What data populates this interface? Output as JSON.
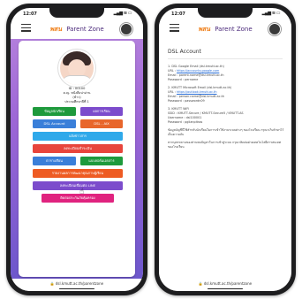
{
  "status_time": "12:07",
  "brand": {
    "logo": "พสน",
    "title": "Parent Zone"
  },
  "left": {
    "student": {
      "id": "ID : 00100",
      "name": "ด.ญ. หนังสือน่าอ่าน",
      "nick": "(ข้าว)",
      "class": "ประถมศึกษาปีที่ 1"
    },
    "buttons": {
      "info": "ข้อมูลนักเรียน",
      "grades": "ผลการเรียน",
      "dsl": "DSL Account",
      "dslaix": "DSL - AIX",
      "news": "แจ้งข่าวสาร",
      "payment": "ลงทะเบียนชำระเงิน",
      "schedule": "ตารางเรียน",
      "docs": "แบบฟอร์มเอกสาร",
      "report": "รายงานผลการพัฒนาคุณภาพผู้เรียน",
      "line": "ลงทะเบียนเชื่อมต่อ LINE",
      "contact": "ติดต่อประกันภัยคุ้มครอง"
    },
    "url": "dsl.kmutt.ac.th/parentzone"
  },
  "right": {
    "title": "DSL Account",
    "sections": [
      {
        "heading": "1. DSL Google Email (dsl.kmutt.ac.th)",
        "url_label": "URL : ",
        "url": "https://accounts.google.com",
        "email": "Email : parent.name@dsl.kmutt.ac.th",
        "password": "Password : pername"
      },
      {
        "heading": "2. KMUTT Microsoft Email (dsl.kmutt.ac.th)",
        "url_label": "URL : ",
        "url": "https://outlook.kmutt.ac.th",
        "email": "Email : person.name@dsl.kmutt.ac.th",
        "password": "Password : passwordn09"
      },
      {
        "heading": "3. KMUTT WiFi",
        "url_label": "SSID : ",
        "url": "KMUTT-Secure / KMUTT-Secure5 / KMUTT-AS",
        "email": "Username : dsl100001",
        "password": "Password : pglianpitsss"
      }
    ],
    "note1": "ข้อมูลบัญชีนี้ใช้สำหรับนักเรียนในการเข้าใช้งานระบบต่างๆ ของโรงเรียน กรุณาเก็บรักษาไว้เป็นความลับ",
    "note2": "หากบุตรหลานของท่านพบปัญหาในการเข้าสู่ระบบ กรุณาติดต่อฝ่ายเทคโนโลยีสารสนเทศของโรงเรียน",
    "url": "dsl.kmutt.ac.th/parentzone"
  }
}
